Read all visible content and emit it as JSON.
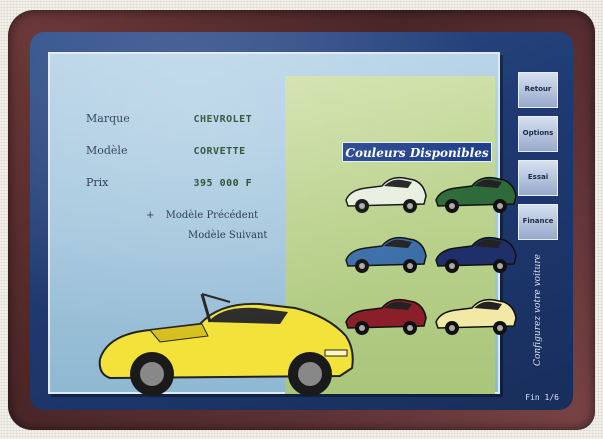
{
  "fields": {
    "make_label": "Marque",
    "make_value": "CHEVROLET",
    "model_label": "Modèle",
    "model_value": "CORVETTE",
    "price_label": "Prix",
    "price_value": "395 000 F"
  },
  "links": {
    "prev_model": "Modèle Précédent",
    "next_model": "Modèle Suivant"
  },
  "colors": {
    "title": "Couleurs Disponibles",
    "swatches": [
      {
        "name": "Blanc",
        "color": "#e8efe0"
      },
      {
        "name": "Vert",
        "color": "#2f6a3a"
      },
      {
        "name": "Bleu",
        "color": "#3b6ea8"
      },
      {
        "name": "Marine",
        "color": "#1f2f6a"
      },
      {
        "name": "Rouge",
        "color": "#8a1f2a"
      },
      {
        "name": "Jaune",
        "color": "#f2e9a6"
      }
    ]
  },
  "hero_color": "#f2e23a",
  "sidebar": {
    "btn1": "Retour",
    "btn2": "Options",
    "btn3": "Essai",
    "btn4": "Finance",
    "vertical_text": "Configurez votre voiture"
  },
  "footer": {
    "page": "Fin 1/6"
  }
}
